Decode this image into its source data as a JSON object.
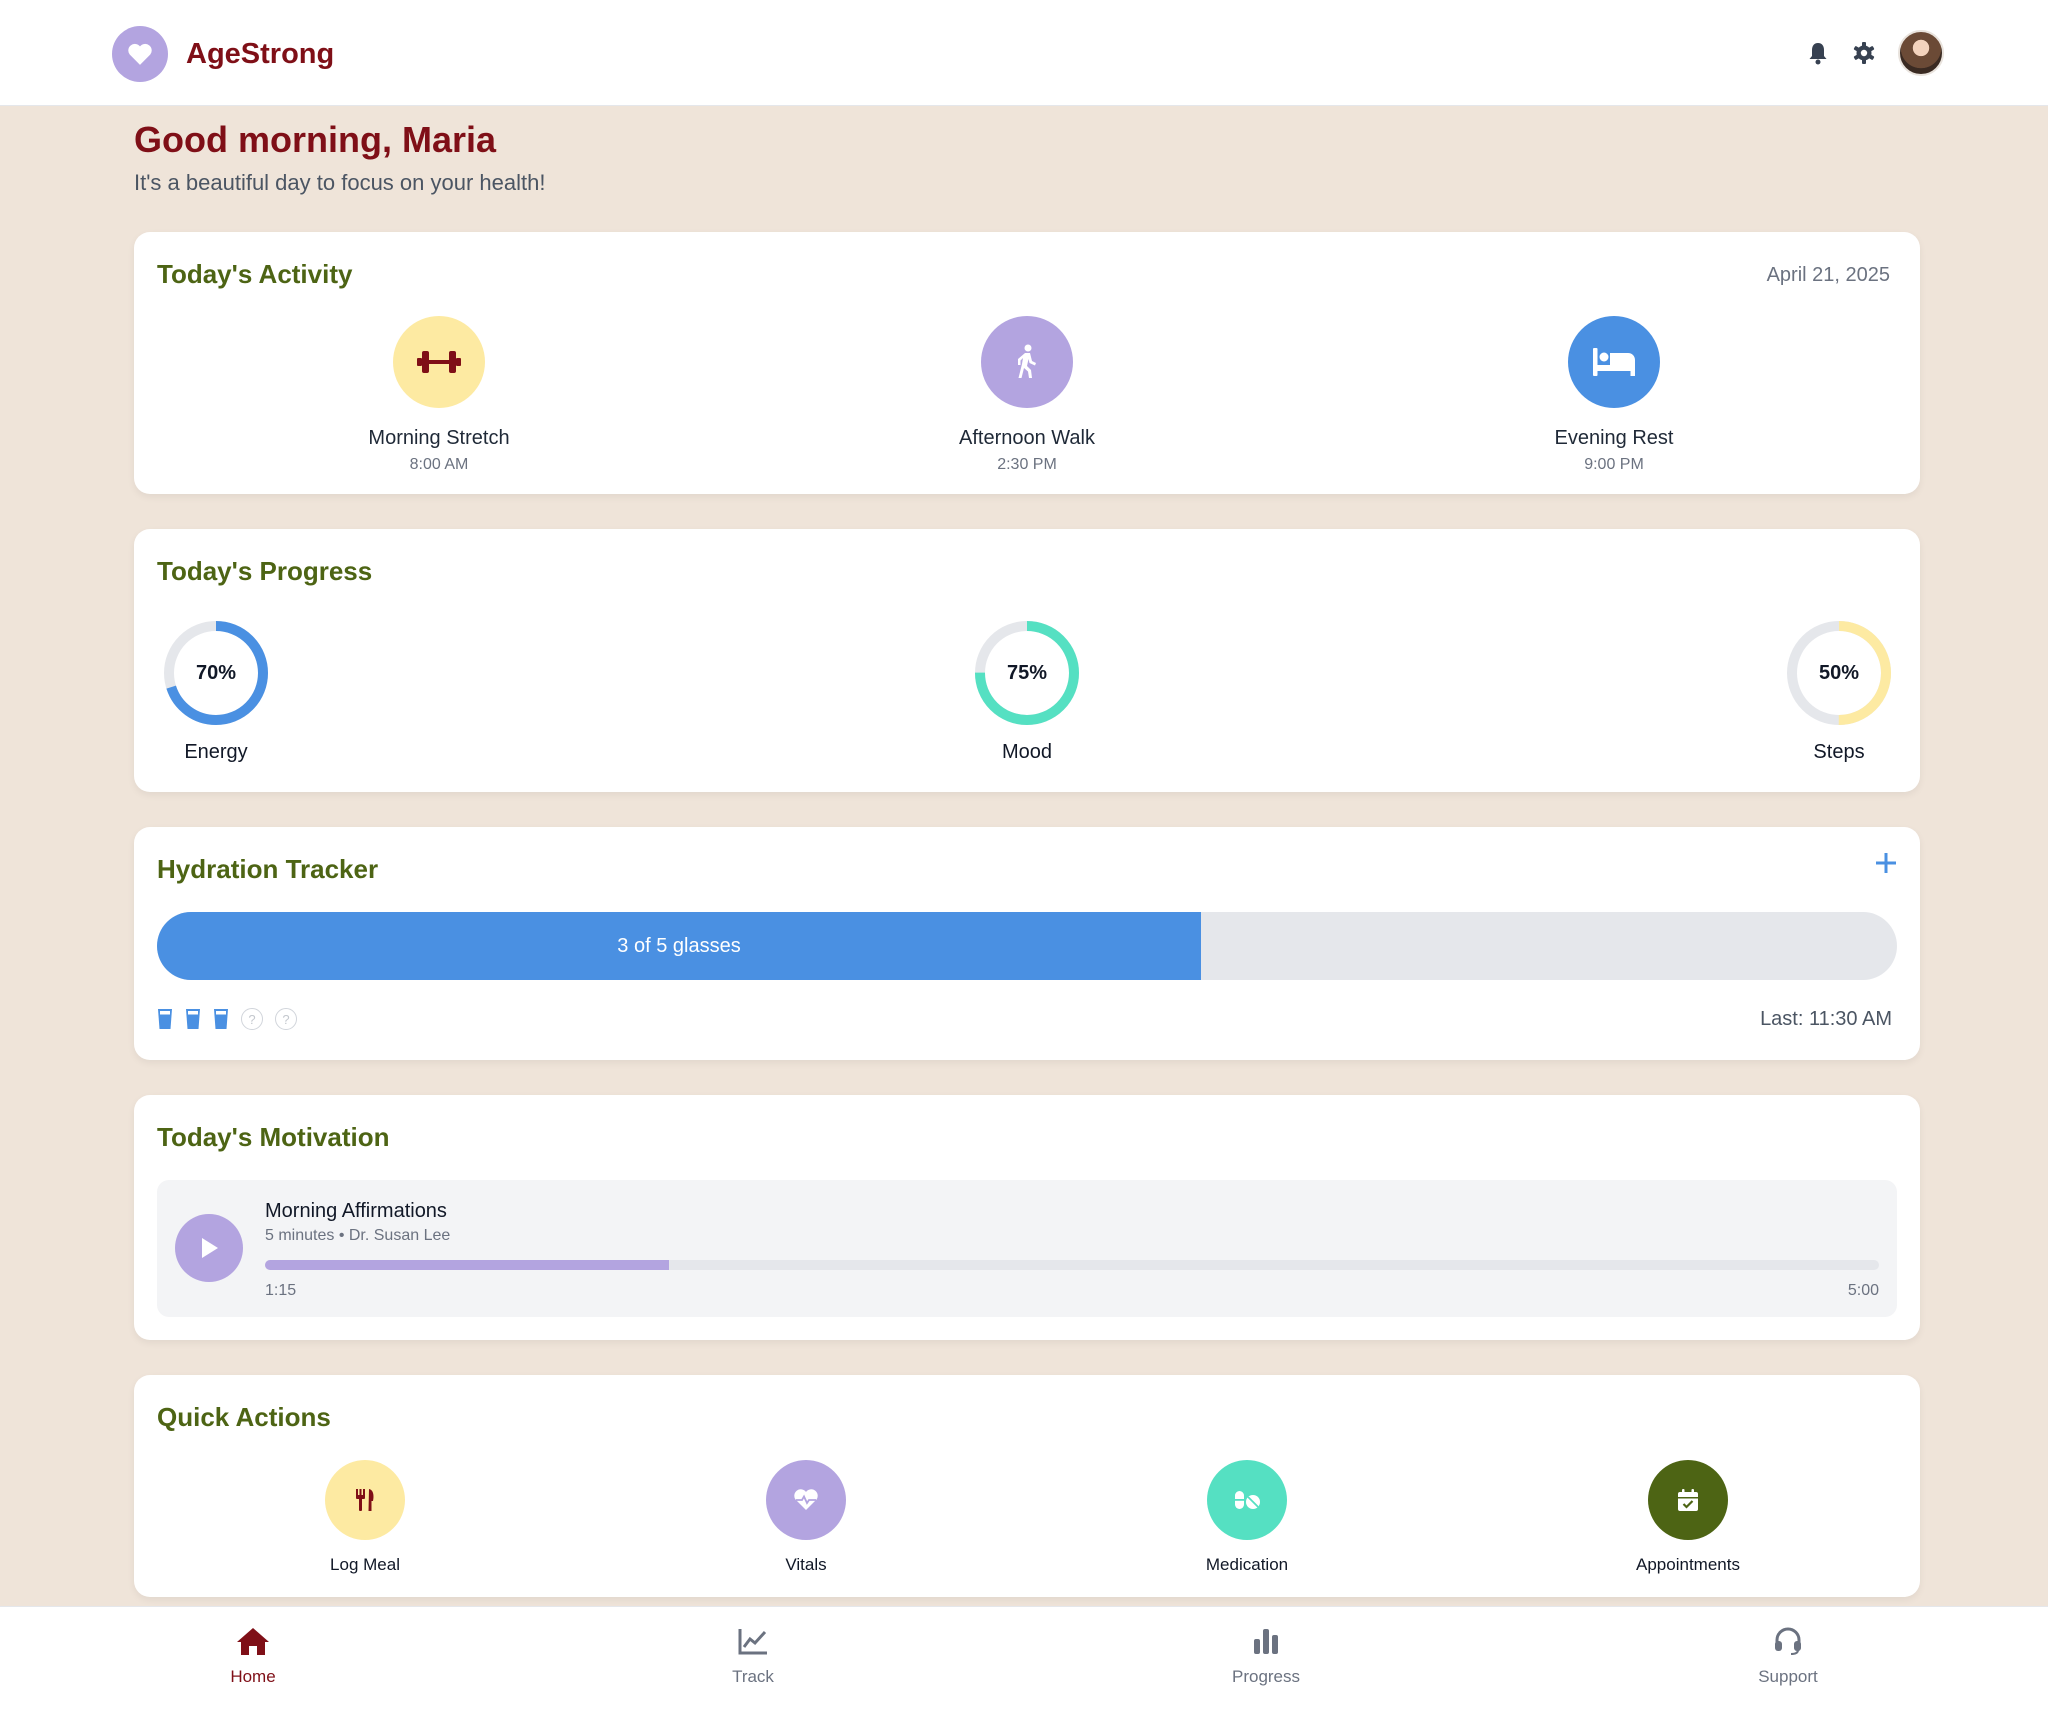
{
  "colors": {
    "brand": "#7f0f17",
    "section_title": "#4d6414",
    "background": "#efe4d9",
    "blue": "#4a90e2",
    "lavender": "#b3a4e0",
    "yellow": "#fdeaa2",
    "teal": "#55e0c2",
    "olive": "#4d6414"
  },
  "header": {
    "app_name": "AgeStrong",
    "logo_icon": "heart-icon",
    "icons": [
      "bell-icon",
      "gear-icon",
      "avatar"
    ]
  },
  "greeting": {
    "title": "Good morning, Maria",
    "subtitle": "It's a beautiful day to focus on your health!"
  },
  "activity": {
    "title": "Today's Activity",
    "date": "April 21, 2025",
    "items": [
      {
        "name": "Morning Stretch",
        "time": "8:00 AM",
        "icon": "dumbbell-icon"
      },
      {
        "name": "Afternoon Walk",
        "time": "2:30 PM",
        "icon": "walking-icon"
      },
      {
        "name": "Evening Rest",
        "time": "9:00 PM",
        "icon": "bed-icon"
      }
    ]
  },
  "progress": {
    "title": "Today's Progress",
    "items": [
      {
        "label": "Energy",
        "value_text": "70%",
        "value": 0.7,
        "color": "#4a90e2"
      },
      {
        "label": "Mood",
        "value_text": "75%",
        "value": 0.75,
        "color": "#55e0c2"
      },
      {
        "label": "Steps",
        "value_text": "50%",
        "value": 0.5,
        "color": "#fdeaa2"
      }
    ]
  },
  "hydration": {
    "title": "Hydration Tracker",
    "add_icon": "plus-icon",
    "progress_text": "3 of 5 glasses",
    "filled": 3,
    "total": 5,
    "empty_glass_glyph": "?",
    "last": "Last: 11:30 AM"
  },
  "motivation": {
    "title": "Today's Motivation",
    "track_title": "Morning Affirmations",
    "track_meta": "5 minutes • Dr. Susan Lee",
    "elapsed": "1:15",
    "duration": "5:00",
    "progress": 0.25
  },
  "quick_actions": {
    "title": "Quick Actions",
    "items": [
      {
        "label": "Log Meal",
        "icon": "utensils-icon"
      },
      {
        "label": "Vitals",
        "icon": "heart-pulse-icon"
      },
      {
        "label": "Medication",
        "icon": "pills-icon"
      },
      {
        "label": "Appointments",
        "icon": "calendar-check-icon"
      }
    ]
  },
  "nav": {
    "items": [
      {
        "label": "Home",
        "icon": "home-icon",
        "active": true
      },
      {
        "label": "Track",
        "icon": "chart-line-icon",
        "active": false
      },
      {
        "label": "Progress",
        "icon": "bar-chart-icon",
        "active": false
      },
      {
        "label": "Support",
        "icon": "headset-icon",
        "active": false
      }
    ]
  }
}
